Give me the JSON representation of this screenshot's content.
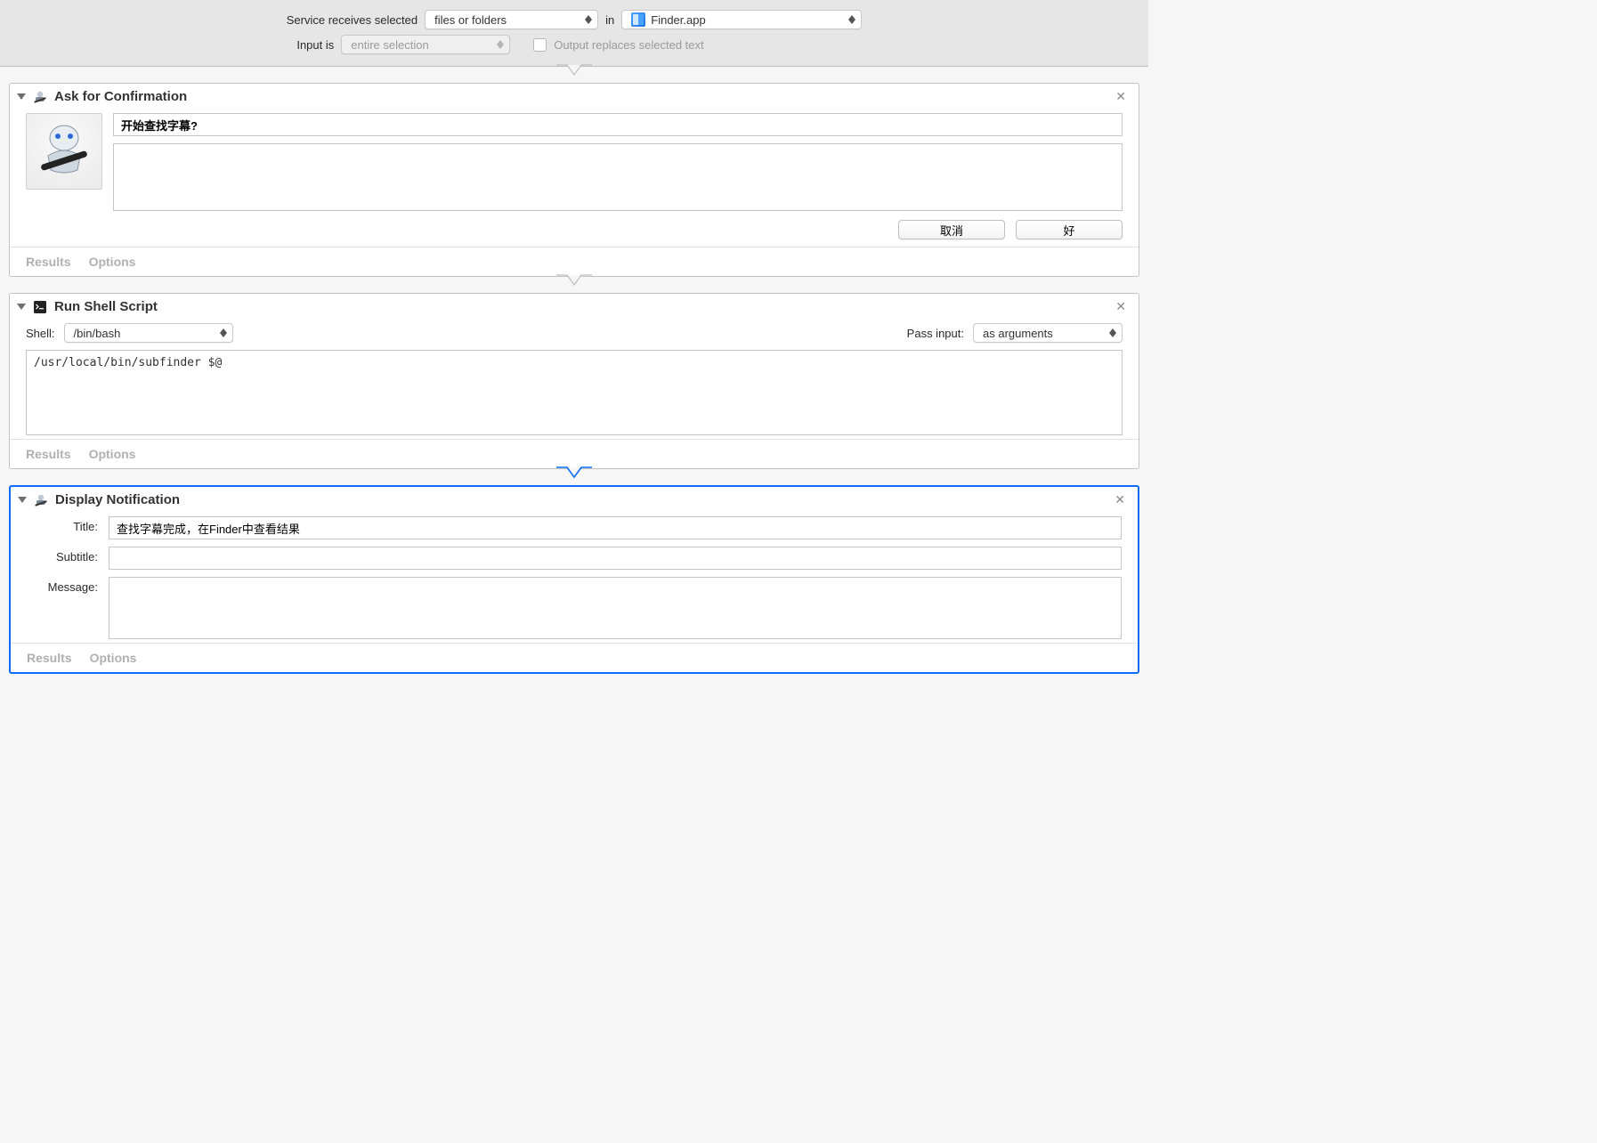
{
  "topbar": {
    "receives_label": "Service receives selected",
    "receives_value": "files or folders",
    "in_label": "in",
    "app_value": "Finder.app",
    "input_is_label": "Input is",
    "input_is_value": "entire selection",
    "output_replaces_label": "Output replaces selected text",
    "output_replaces_checked": false
  },
  "actions": {
    "ask": {
      "title": "Ask for Confirmation",
      "prompt_value": "开始查找字幕?",
      "details_value": "",
      "cancel_button": "取消",
      "ok_button": "好"
    },
    "shell": {
      "title": "Run Shell Script",
      "shell_label": "Shell:",
      "shell_value": "/bin/bash",
      "pass_input_label": "Pass input:",
      "pass_input_value": "as arguments",
      "script_value": "/usr/local/bin/subfinder $@"
    },
    "notify": {
      "title": "Display Notification",
      "title_label": "Title:",
      "title_value": "查找字幕完成，在Finder中查看结果",
      "subtitle_label": "Subtitle:",
      "subtitle_value": "",
      "message_label": "Message:",
      "message_value": ""
    }
  },
  "footer": {
    "results": "Results",
    "options": "Options"
  }
}
